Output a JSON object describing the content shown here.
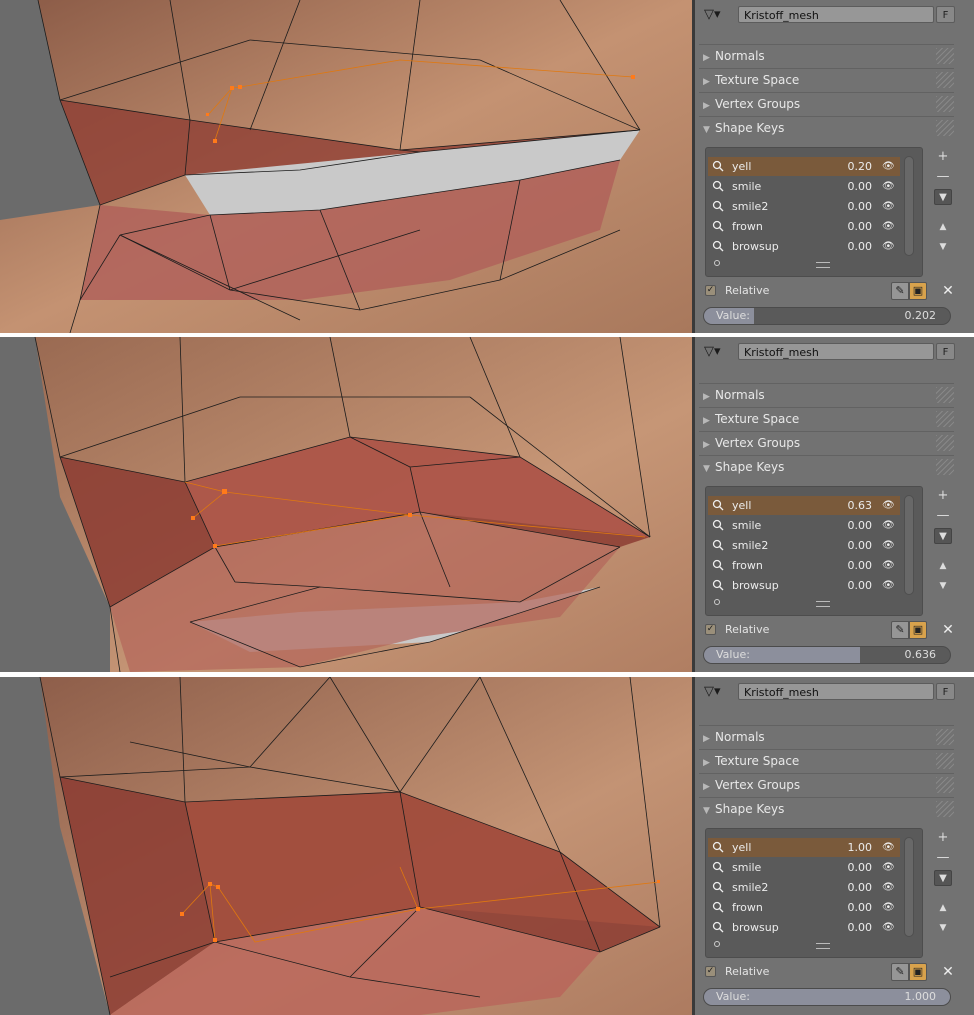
{
  "frames": [
    {
      "mesh_name": "Kristoff_mesh",
      "mesh_flag": "F",
      "panels": [
        "Normals",
        "Texture Space",
        "Vertex Groups",
        "Shape Keys"
      ],
      "shape_keys": [
        {
          "name": "yell",
          "value": "0.20",
          "active": true
        },
        {
          "name": "smile",
          "value": "0.00"
        },
        {
          "name": "smile2",
          "value": "0.00"
        },
        {
          "name": "frown",
          "value": "0.00"
        },
        {
          "name": "browsup",
          "value": "0.00"
        }
      ],
      "relative_label": "Relative",
      "value_label": "Value:",
      "value_text": "0.202",
      "value_fraction": 0.202
    },
    {
      "mesh_name": "Kristoff_mesh",
      "mesh_flag": "F",
      "panels": [
        "Normals",
        "Texture Space",
        "Vertex Groups",
        "Shape Keys"
      ],
      "shape_keys": [
        {
          "name": "yell",
          "value": "0.63",
          "active": true
        },
        {
          "name": "smile",
          "value": "0.00"
        },
        {
          "name": "smile2",
          "value": "0.00"
        },
        {
          "name": "frown",
          "value": "0.00"
        },
        {
          "name": "browsup",
          "value": "0.00"
        }
      ],
      "relative_label": "Relative",
      "value_label": "Value:",
      "value_text": "0.636",
      "value_fraction": 0.636
    },
    {
      "mesh_name": "Kristoff_mesh",
      "mesh_flag": "F",
      "panels": [
        "Normals",
        "Texture Space",
        "Vertex Groups",
        "Shape Keys"
      ],
      "shape_keys": [
        {
          "name": "yell",
          "value": "1.00",
          "active": true
        },
        {
          "name": "smile",
          "value": "0.00"
        },
        {
          "name": "smile2",
          "value": "0.00"
        },
        {
          "name": "frown",
          "value": "0.00"
        },
        {
          "name": "browsup",
          "value": "0.00"
        }
      ],
      "relative_label": "Relative",
      "value_label": "Value:",
      "value_text": "1.000",
      "value_fraction": 1.0
    }
  ],
  "icons": {
    "mesh": "mesh-data-icon",
    "shape_key": "shape-key-icon",
    "eye": "eye-icon",
    "add": "plus-icon",
    "remove": "minus-icon",
    "specials": "dropdown-arrow-icon",
    "move_up": "triangle-up-icon",
    "move_down": "triangle-down-icon",
    "pin": "pin-icon",
    "lock": "lock-icon",
    "clear": "close-icon"
  },
  "colors": {
    "active_row": "#7a5a3b",
    "selected_vertex": "#ff7a1a",
    "skin": "#b07a62",
    "lip": "#a0483e"
  }
}
